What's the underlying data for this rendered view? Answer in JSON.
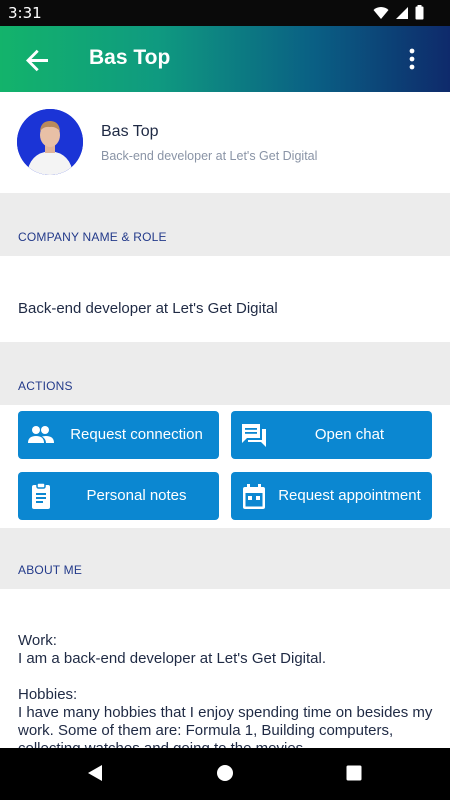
{
  "status_bar": {
    "time": "3:31"
  },
  "app_bar": {
    "title": "Bas Top"
  },
  "profile": {
    "name": "Bas Top",
    "subtitle": "Back-end developer at Let's Get Digital"
  },
  "sections": {
    "company": {
      "header": "COMPANY NAME & ROLE",
      "value": "Back-end developer at Let's Get Digital"
    },
    "actions": {
      "header": "ACTIONS",
      "buttons": [
        {
          "label": "Request connection",
          "icon": "people-icon"
        },
        {
          "label": "Open chat",
          "icon": "chat-icon"
        },
        {
          "label": "Personal notes",
          "icon": "clipboard-icon"
        },
        {
          "label": "Request appointment",
          "icon": "calendar-icon"
        }
      ]
    },
    "about": {
      "header": "ABOUT ME",
      "work_heading": "Work:",
      "work_text": "I am a back-end developer at Let's Get Digital.",
      "hobbies_heading": "Hobbies:",
      "hobbies_text": "I have many hobbies that I enjoy spending time on besides my work. Some of them are: Formula 1, Building computers, collecting watches and going to the movies."
    }
  },
  "colors": {
    "button_blue": "#0b87d1",
    "header_gradient_start": "#13b36b",
    "header_gradient_end": "#0e2a6b",
    "section_label": "#233a8a"
  }
}
